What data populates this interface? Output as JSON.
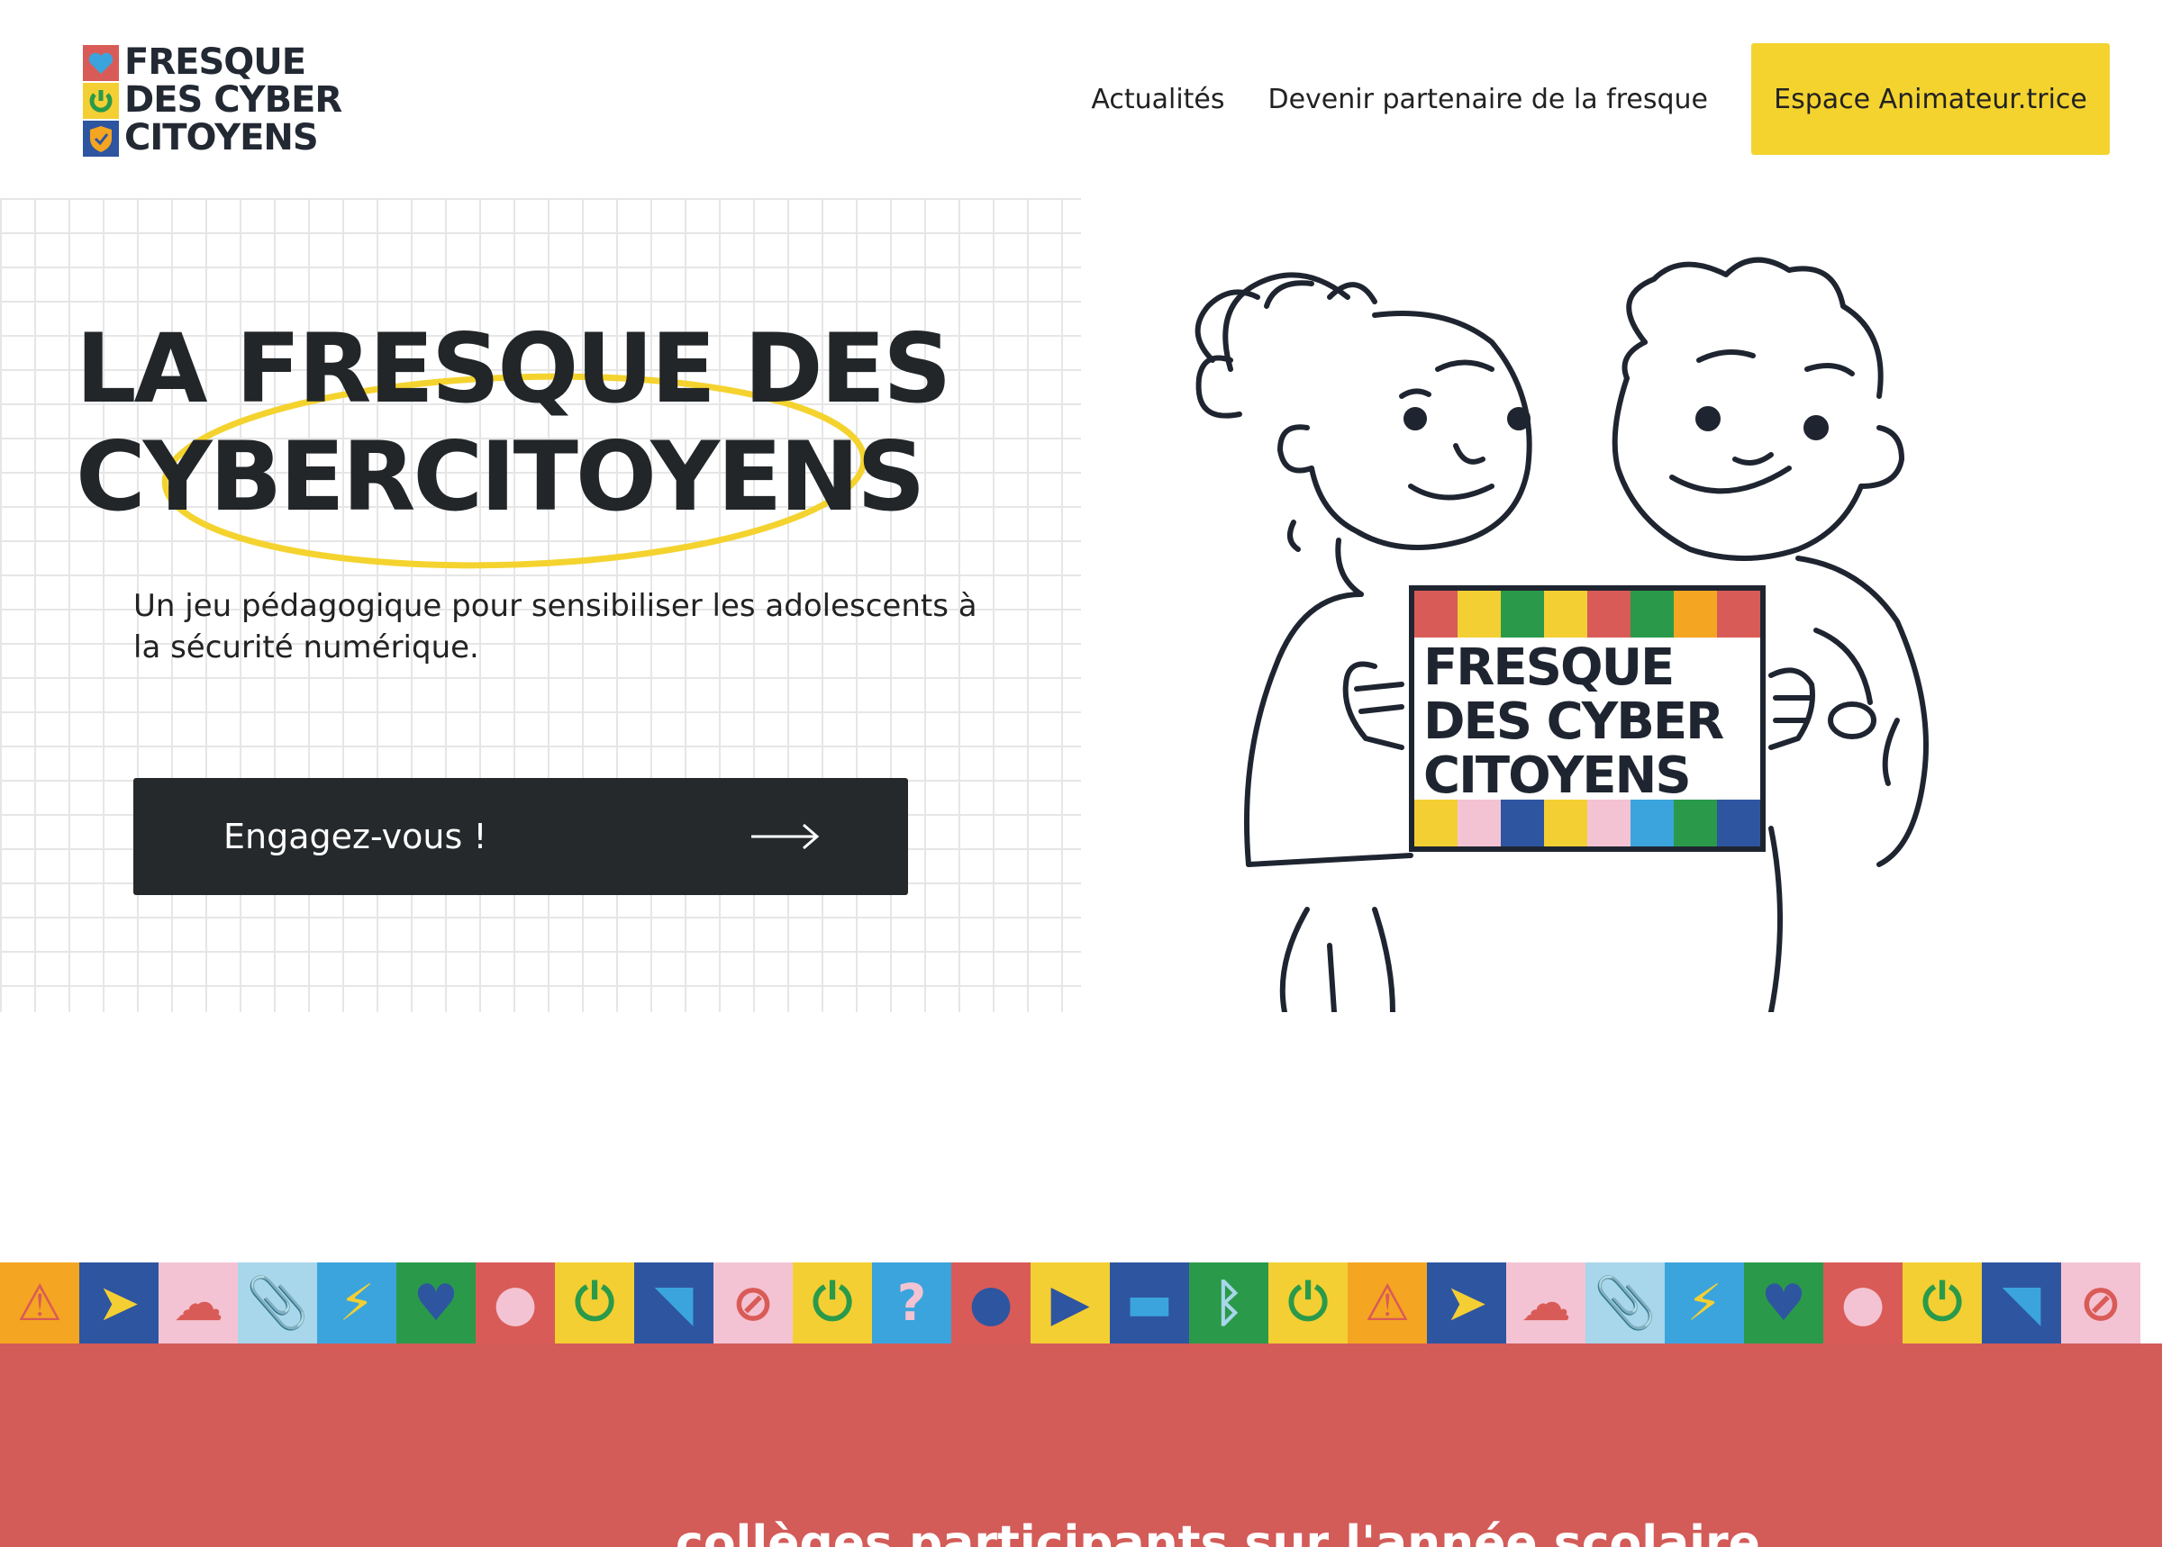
{
  "header": {
    "logo_lines": [
      "FRESQUE",
      "DES CYBER",
      "CITOYENS"
    ],
    "nav": [
      {
        "label": "Actualités"
      },
      {
        "label": "Devenir partenaire de la fresque"
      }
    ],
    "cta_label": "Espace Animateur.trice"
  },
  "hero": {
    "title_lines": [
      "LA FRESQUE DES",
      "CYBERCITOYENS"
    ],
    "subtitle": "Un jeu pédagogique pour sensibiliser les adolescents à la sécurité numérique.",
    "button_label": "Engagez-vous !",
    "button_icon": "arrow-right-icon"
  },
  "illustration": {
    "sign_lines": [
      "FRESQUE",
      "DES CYBER",
      "CITOYENS"
    ]
  },
  "banner": {
    "tiles": [
      {
        "icon": "warning-icon",
        "bg": "#f4a521",
        "fg": "#d95b57",
        "glyph": "⚠"
      },
      {
        "icon": "cursor-icon",
        "bg": "#2e55a0",
        "fg": "#f4cf33",
        "glyph": "➤"
      },
      {
        "icon": "cloud-upload-icon",
        "bg": "#f4c3d3",
        "fg": "#d95b57",
        "glyph": "☁"
      },
      {
        "icon": "paperclip-icon",
        "bg": "#a8d6ea",
        "fg": "#2a9a4a",
        "glyph": "📎"
      },
      {
        "icon": "lightning-icon",
        "bg": "#3ba4dc",
        "fg": "#f4cf33",
        "glyph": "⚡"
      },
      {
        "icon": "heart-icon",
        "bg": "#2a9a4a",
        "fg": "#2e55a0",
        "glyph": "♥"
      },
      {
        "icon": "mouse-icon",
        "bg": "#d95b57",
        "fg": "#f4c3d3",
        "glyph": "●"
      },
      {
        "icon": "power-icon",
        "bg": "#f4cf33",
        "fg": "#2a9a4a",
        "glyph": "⏻"
      },
      {
        "icon": "chat-icon",
        "bg": "#2e55a0",
        "fg": "#3ba4dc",
        "glyph": "◥"
      },
      {
        "icon": "camera-off-icon",
        "bg": "#f4c3d3",
        "fg": "#d95b57",
        "glyph": "⊘"
      },
      {
        "icon": "power-icon",
        "bg": "#f4cf33",
        "fg": "#2a9a4a",
        "glyph": "⏻"
      },
      {
        "icon": "question-icon",
        "bg": "#3ba4dc",
        "fg": "#f4c3d3",
        "glyph": "?"
      },
      {
        "icon": "keyhole-icon",
        "bg": "#d95b57",
        "fg": "#2e55a0",
        "glyph": "●"
      },
      {
        "icon": "play-next-icon",
        "bg": "#f4cf33",
        "fg": "#2e55a0",
        "glyph": "▶"
      },
      {
        "icon": "monitor-icon",
        "bg": "#2e55a0",
        "fg": "#3ba4dc",
        "glyph": "▬"
      },
      {
        "icon": "bluetooth-icon",
        "bg": "#2a9a4a",
        "fg": "#a8d6ea",
        "glyph": "ᛒ"
      },
      {
        "icon": "power-icon",
        "bg": "#f4cf33",
        "fg": "#2a9a4a",
        "glyph": "⏻"
      },
      {
        "icon": "warning-icon",
        "bg": "#f4a521",
        "fg": "#d95b57",
        "glyph": "⚠"
      },
      {
        "icon": "cursor-icon",
        "bg": "#2e55a0",
        "fg": "#f4cf33",
        "glyph": "➤"
      },
      {
        "icon": "cloud-upload-icon",
        "bg": "#f4c3d3",
        "fg": "#d95b57",
        "glyph": "☁"
      },
      {
        "icon": "paperclip-icon",
        "bg": "#a8d6ea",
        "fg": "#2a9a4a",
        "glyph": "📎"
      },
      {
        "icon": "lightning-icon",
        "bg": "#3ba4dc",
        "fg": "#f4cf33",
        "glyph": "⚡"
      },
      {
        "icon": "heart-icon",
        "bg": "#2a9a4a",
        "fg": "#2e55a0",
        "glyph": "♥"
      },
      {
        "icon": "mouse-icon",
        "bg": "#d95b57",
        "fg": "#f4c3d3",
        "glyph": "●"
      },
      {
        "icon": "power-icon",
        "bg": "#f4cf33",
        "fg": "#2a9a4a",
        "glyph": "⏻"
      },
      {
        "icon": "chat-icon",
        "bg": "#2e55a0",
        "fg": "#3ba4dc",
        "glyph": "◥"
      },
      {
        "icon": "camera-off-icon",
        "bg": "#f4c3d3",
        "fg": "#d95b57",
        "glyph": "⊘"
      }
    ]
  },
  "stats": {
    "number": "",
    "text": "collèges participants sur l'année scolaire"
  },
  "colors": {
    "accent_yellow": "#f4d32f",
    "dark": "#25292b",
    "stats_red": "#d35b58"
  }
}
